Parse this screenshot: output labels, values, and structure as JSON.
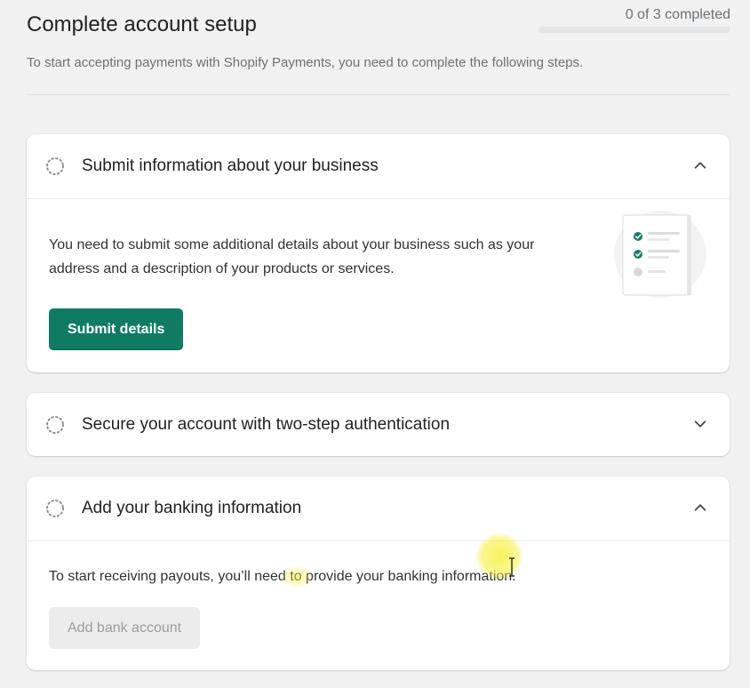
{
  "header": {
    "title": "Complete account setup",
    "progress_text": "0 of 3 completed",
    "progress_fraction": 0,
    "subtitle": "To start accepting payments with Shopify Payments, you need to complete the following steps."
  },
  "steps": [
    {
      "title": "Submit information about your business",
      "expanded": true,
      "description": "You need to submit some additional details about your business such as your address and a description of your products or services.",
      "button_label": "Submit details",
      "button_state": "primary"
    },
    {
      "title": "Secure your account with two-step authentication",
      "expanded": false
    },
    {
      "title": "Add your banking information",
      "expanded": true,
      "description": "To start receiving payouts, you’ll need to provide your banking information.",
      "button_label": "Add bank account",
      "button_state": "disabled"
    }
  ],
  "colors": {
    "accent": "#0f7b63",
    "page_bg": "#f1f1f1",
    "card_bg": "#ffffff",
    "muted_text": "#6d7175"
  },
  "icons": {
    "step_status": "dashed-circle-icon",
    "expand": "chevron-up-icon",
    "collapse": "chevron-down-icon",
    "illustration": "checklist-illustration"
  }
}
